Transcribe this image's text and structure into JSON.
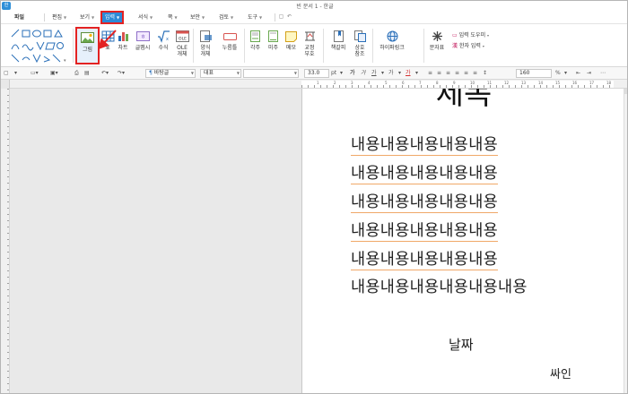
{
  "window": {
    "title": "빈 문서 1 - 한글",
    "app_icon": "한"
  },
  "menu": {
    "file": "파일",
    "items": [
      {
        "label": "편집"
      },
      {
        "label": "보기"
      },
      {
        "label": "입력"
      },
      {
        "label": "서식"
      },
      {
        "label": "쪽"
      },
      {
        "label": "보안"
      },
      {
        "label": "검토"
      },
      {
        "label": "도구"
      }
    ],
    "active_index": 2
  },
  "ribbon": {
    "picture": "그림",
    "table": "표",
    "chart": "차트",
    "formula": "글맵시",
    "equation": "수식",
    "ole_1": "OLE",
    "ole_2": "개체",
    "form_1": "양식",
    "form_2": "개체",
    "nurimbong": "누름틀",
    "footnote": "각주",
    "endnote": "미주",
    "memo": "메모",
    "correction_1": "교정",
    "correction_2": "부호",
    "bookmark": "책갈피",
    "crossref_1": "상호",
    "crossref_2": "참조",
    "hyperlink": "하이퍼링크",
    "character_table": "문자표",
    "input_helper": "입력 도우미",
    "hanja_input": "한자 입력"
  },
  "format_bar": {
    "style": "바탕글",
    "font": "대표",
    "size": "33.0",
    "unit": "pt",
    "bold": "가",
    "italic": "가",
    "underline": "가",
    "strike": "가",
    "color": "가",
    "line_spacing": "160",
    "percent": "%"
  },
  "ruler": {
    "marks": [
      "1",
      "2",
      "3",
      "4",
      "5",
      "6",
      "7",
      "8",
      "9",
      "10",
      "11",
      "12",
      "13",
      "14",
      "15",
      "16",
      "17",
      "18"
    ]
  },
  "document": {
    "title": "제목",
    "lines": [
      "내용내용내용내용내용",
      "내용내용내용내용내용",
      "내용내용내용내용내용",
      "내용내용내용내용내용",
      "내용내용내용내용내용",
      "내용내용내용내용내용내용"
    ],
    "date": "날짜",
    "signature": "싸인"
  },
  "colors": {
    "accent": "#2d8ad7",
    "highlight": "#e32222",
    "underline": "#f0a868"
  }
}
